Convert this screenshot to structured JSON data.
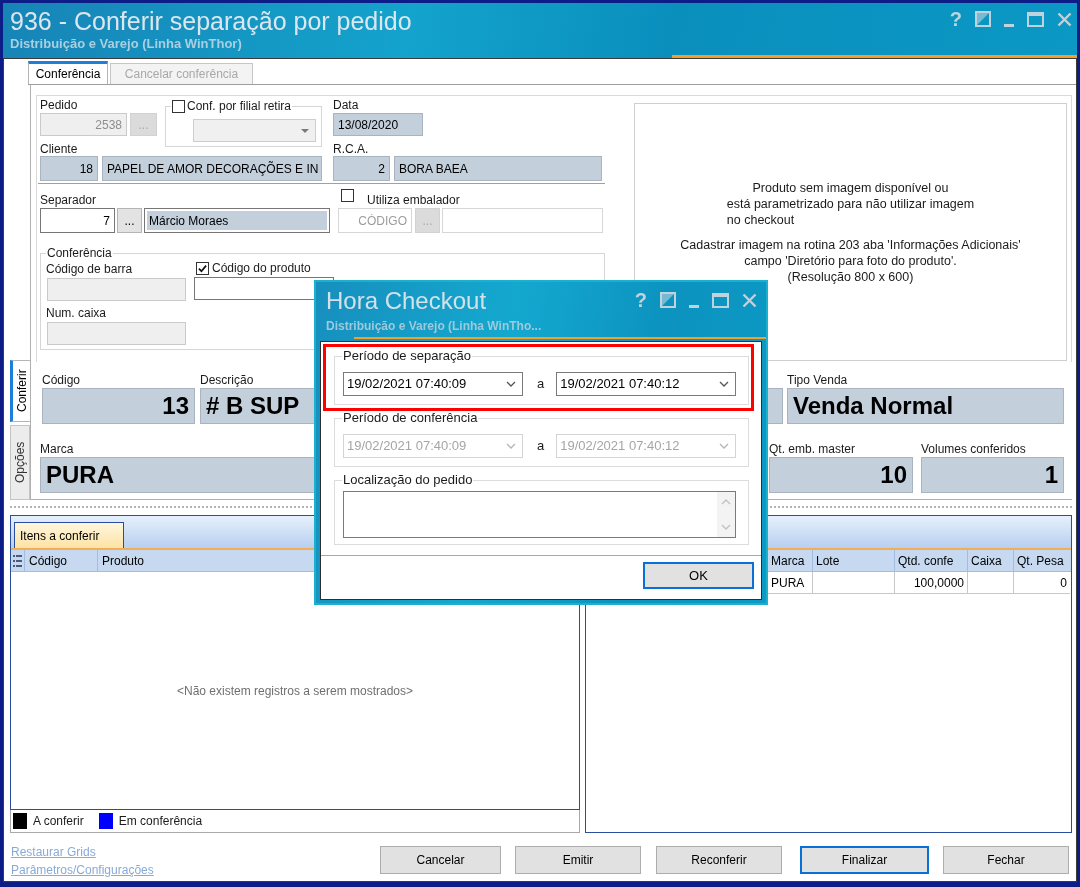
{
  "window": {
    "title": "936 - Conferir separação por pedido",
    "subtitle": "Distribuição e Varejo (Linha WinThor)",
    "help": "?"
  },
  "tabs": [
    {
      "label": "Conferência",
      "selected": true
    },
    {
      "label": "Cancelar conferência",
      "selected": false
    }
  ],
  "side_tabs": [
    {
      "label": "Conferir",
      "selected": true
    },
    {
      "label": "Opções",
      "selected": false
    }
  ],
  "pedido": {
    "label": "Pedido",
    "value": "2538",
    "button": "...",
    "disabled": true
  },
  "filial_retira": {
    "label": "Conf. por filial retira",
    "checked": false
  },
  "data": {
    "label": "Data",
    "value": "13/08/2020"
  },
  "cliente": {
    "label": "Cliente",
    "code": "18",
    "name": "PAPEL DE AMOR DECORAÇÕES E IN"
  },
  "rca": {
    "label": "R.C.A.",
    "code": "2",
    "name": "BORA BAEA"
  },
  "separador": {
    "label": "Separador",
    "code": "7",
    "button": "...",
    "name": "Márcio Moraes"
  },
  "embalador": {
    "label": "Utiliza embalador",
    "checked": false,
    "placeholder": "CÓDIGO",
    "button": "..."
  },
  "conferencia": {
    "title": "Conferência",
    "barcode": {
      "label": "Código de barra",
      "disabled": true
    },
    "product_code": {
      "label": "Código do produto",
      "checked": true
    },
    "box": {
      "label": "Num. caixa",
      "disabled": true
    }
  },
  "image_message": {
    "notice": [
      "Produto sem imagem disponível ou",
      "está parametrizado para não utilizar imagem",
      "no checkout"
    ],
    "instructions": [
      "Cadastrar imagem na rotina 203 aba 'Informações Adicionais'",
      "campo 'Diretório para foto do produto'.",
      "(Resolução 800 x 600)"
    ]
  },
  "product": {
    "codigo": {
      "label": "Código",
      "value": "13"
    },
    "descricao": {
      "label": "Descrição",
      "value": "# B SUP"
    },
    "tipo_venda": {
      "label": "Tipo Venda",
      "value": "Venda Normal"
    },
    "marca": {
      "label": "Marca",
      "value": "PURA"
    },
    "qt_emb_master": {
      "label": "Qt. emb. master",
      "value": "10"
    },
    "volumes_conferidos": {
      "label": "Volumes conferidos",
      "value": "1"
    }
  },
  "items_grid": {
    "tab": "Itens a conferir",
    "columns": [
      "Código",
      "Produto"
    ],
    "empty_message": "<Não existem registros a serem mostrados>",
    "legend": [
      {
        "label": "A conferir",
        "color": "#000000"
      },
      {
        "label": "Em conferência",
        "color": "#0000ff"
      }
    ]
  },
  "checked_grid": {
    "columns": [
      "Marca",
      "Lote",
      "Qtd. confe",
      "Caixa",
      "Qt. Pesa"
    ],
    "rows": [
      [
        "PURA",
        null,
        "100,0000",
        null,
        "0"
      ]
    ]
  },
  "footer": {
    "links": [
      "Restaurar Grids",
      "Parâmetros/Configurações"
    ],
    "buttons": [
      {
        "label": "Cancelar",
        "focused": false
      },
      {
        "label": "Emitir",
        "focused": false
      },
      {
        "label": "Reconferir",
        "focused": false
      },
      {
        "label": "Finalizar",
        "focused": true
      },
      {
        "label": "Fechar",
        "focused": false
      }
    ]
  },
  "dialog": {
    "title": "Hora Checkout",
    "subtitle": "Distribuição e Varejo (Linha WinTho...",
    "help": "?",
    "groups": [
      {
        "kind": "range",
        "title": "Período de separação",
        "from": "19/02/2021 07:40:09",
        "joiner": "a",
        "to": "19/02/2021 07:40:12",
        "disabled": false,
        "highlighted": true
      },
      {
        "kind": "range",
        "title": "Período de conferência",
        "from": "19/02/2021 07:40:09",
        "joiner": "a",
        "to": "19/02/2021 07:40:12",
        "disabled": true,
        "highlighted": false
      },
      {
        "kind": "memo",
        "title": "Localização do pedido",
        "highlighted": false
      }
    ],
    "ok_button": {
      "label": "OK",
      "focused": true
    }
  }
}
